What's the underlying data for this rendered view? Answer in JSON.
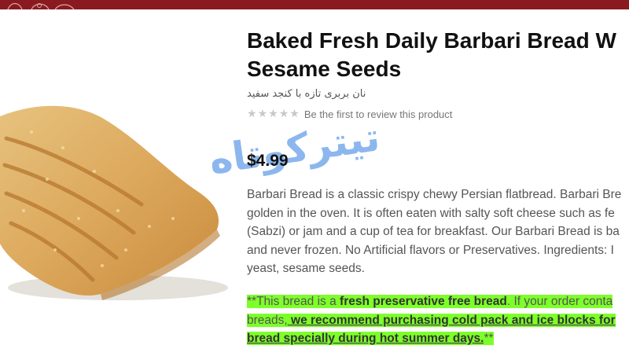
{
  "product": {
    "title_line1": "Baked Fresh Daily Barbari Bread W",
    "title_line2": "Sesame Seeds",
    "persian_name": "نان بربری تازه با کنجد سفید",
    "rating": {
      "stars_filled": 0,
      "stars_total": 5,
      "review_text": "Be the first to review this product"
    },
    "watermark_text": "تیترکوتاه",
    "price": "$4.99",
    "description_lines": [
      "Barbari Bread is a classic crispy chewy Persian flatbread. Barbari Bre",
      "golden in the oven. It is often eaten with salty soft cheese such as fe",
      "(Sabzi) or jam and a cup of tea for breakfast. Our Barbari Bread is ba",
      "and never frozen. No Artificial flavors or Preservatives. Ingredients: I",
      "yeast, sesame seeds."
    ],
    "notice": {
      "l1_pre": "**This bread is a ",
      "l1_bold": "fresh preservative free bread",
      "l1_post": ". If your order conta",
      "l2_pre": "breads,",
      "l2_ul": " we recommend purchasing cold pack and ice blocks for",
      "l3_ul": "bread specially during hot summer days.",
      "l3_post": "**"
    }
  },
  "colors": {
    "topbar": "#8a1a1f",
    "highlight": "#7dff2a",
    "watermark": "#2f7de1"
  },
  "icons": [
    "star-icon",
    "bread-image",
    "watermark-logo"
  ]
}
